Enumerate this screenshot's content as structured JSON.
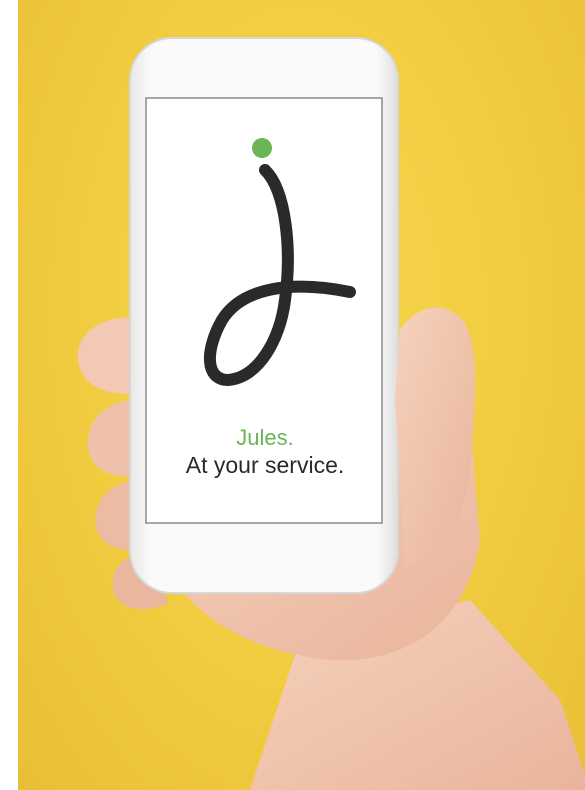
{
  "app": {
    "name_line": "Jules.",
    "tagline": "At your service."
  },
  "colors": {
    "background": "#f2cd43",
    "accent_green": "#6cb556",
    "logo_dark": "#2a2a2a",
    "phone_body": "#f4f4f4",
    "screen": "#ffffff",
    "skin": "#f0c4ad"
  },
  "icons": {
    "logo": "jules-j-logo-icon",
    "dot": "green-dot-icon"
  }
}
